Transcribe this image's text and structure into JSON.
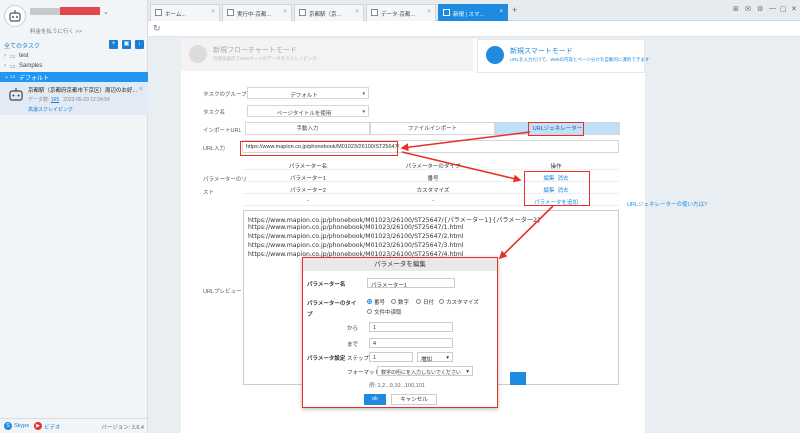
{
  "sidebar": {
    "pay_link": "料金を払うに行く >>",
    "all_tasks": "全てのタスク",
    "groups": [
      {
        "label": "test"
      },
      {
        "label": "Samples"
      },
      {
        "label": "デフォルト"
      }
    ],
    "task": {
      "title": "京都駅（京都府京都市下京区）周辺のお好...",
      "data_label": "データ数:",
      "data_count": "165",
      "date": "2023-05-29 12:34:54",
      "status": "高速スクレイピング"
    },
    "footer": {
      "skype": "Skype",
      "video": "ビデオ",
      "version": "バージョン: 3.6.4"
    }
  },
  "tabs": [
    {
      "label": "ホーム..."
    },
    {
      "label": "実行中-京都..."
    },
    {
      "label": "京都駅（京..."
    },
    {
      "label": "データ-京都..."
    },
    {
      "label": "新規 | スマ..."
    }
  ],
  "modes": {
    "flowchart": {
      "title": "新規フローチャートモード",
      "desc": "可視化操作でWebページのデータをスクレイピング、"
    },
    "smart": {
      "title": "新規スマートモード",
      "desc": "URLを入力だけで、Webの内容とページ分けを自動的に識別できます"
    }
  },
  "form": {
    "group_label": "タスクのグループ",
    "group_value": "デフォルト",
    "name_label": "タスク名",
    "name_value": "ページタイトルを使用",
    "import_label": "インポートURL",
    "import_tabs": [
      "手動入力",
      "ファイルインポート",
      "URLジェネレーター"
    ],
    "url_label": "URL入力",
    "url_value": "https://www.mapion.co.jp/phonebook/M01023/26100/ST25647/",
    "param_label_1": "パラメーターのリ",
    "param_label_2": "スト",
    "param_headers": [
      "パラメーター名",
      "パラメーターのタイプ",
      "操作"
    ],
    "params": [
      {
        "name": "パラメーター1",
        "type": "番号",
        "edit": "編集",
        "delete": "消去"
      },
      {
        "name": "パラメーター2",
        "type": "カスタマイズ",
        "edit": "編集",
        "delete": "消去"
      }
    ],
    "empty_cell": "-",
    "add_param": "パラメータを追加",
    "help_link": "URLジェネレーターの使い方は?",
    "preview_label": "URLプレビュー",
    "preview_lines": [
      "https://www.mapion.co.jp/phonebook/M01023/26100/ST25647/{パラメーター1}{パラメーター2}",
      "https://www.mapion.co.jp/phonebook/M01023/26100/ST25647/1.html",
      "https://www.mapion.co.jp/phonebook/M01023/26100/ST25647/2.html",
      "https://www.mapion.co.jp/phonebook/M01023/26100/ST25647/3.html",
      "https://www.mapion.co.jp/phonebook/M01023/26100/ST25647/4.html"
    ]
  },
  "dialog": {
    "title": "パラメータを編集",
    "name_label": "パラメーター名",
    "name_value": "パラメーター1",
    "type_label_1": "パラメーターのタイ",
    "type_label_2": "プ",
    "types": [
      "番号",
      "数字",
      "日付",
      "カスタマイズ",
      "文件中读取"
    ],
    "from_label": "から",
    "from_value": "1",
    "to_label": "まで",
    "to_value": "4",
    "settings_label": "パラメータ設定",
    "step_label": "ステップ",
    "step_value": "1",
    "step_mode": "増加",
    "format_label": "フォーマット",
    "format_value": "数字の桁にを入力しないでください",
    "example": "例: 1,2...9,10...100,101",
    "ok": "ok",
    "cancel": "キャンセル"
  },
  "colors": {
    "accent": "#1e8be0",
    "annotation": "#e6302a",
    "active_tab_bg": "#bfe0f8"
  }
}
